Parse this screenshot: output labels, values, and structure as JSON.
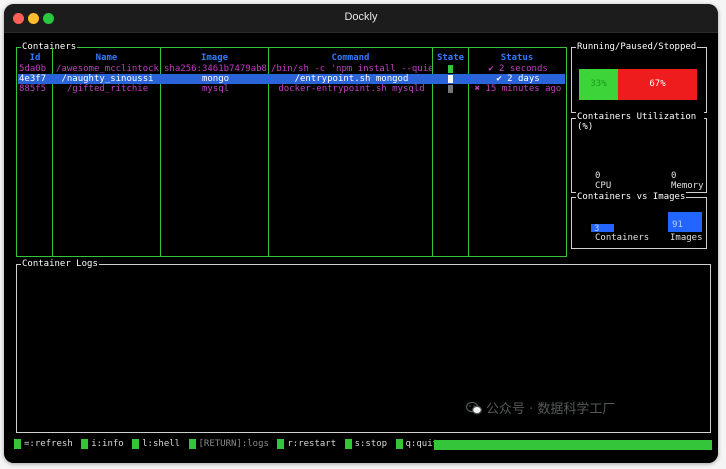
{
  "window": {
    "title": "Dockly"
  },
  "containers": {
    "title": "Containers",
    "headers": [
      "Id",
      "Name",
      "Image",
      "Command",
      "State",
      "Status"
    ],
    "rows": [
      {
        "id": "5da0b",
        "name": "/awesome_mcclintock",
        "image": "sha256:3461b7479ab8",
        "command": "/bin/sh -c 'npm install --quie",
        "state": "running",
        "status": "✔ 2 seconds"
      },
      {
        "id": "4e3f7",
        "name": "/naughty_sinoussi",
        "image": "mongo",
        "command": "/entrypoint.sh mongod",
        "state": "running",
        "status": "✔ 2 days"
      },
      {
        "id": "885f5",
        "name": "/gifted_ritchie",
        "image": "mysql",
        "command": "docker-entrypoint.sh mysqld",
        "state": "stopped",
        "status": "✖ 15 minutes ago"
      }
    ],
    "selected_row": 1
  },
  "running_paused_stopped": {
    "title": "Running/Paused/Stopped",
    "running_pct": "33%",
    "stopped_pct": "67%",
    "running_fraction": 0.33,
    "colors": {
      "running": "#3dd43a",
      "stopped": "#ee1c1c"
    }
  },
  "utilization": {
    "title": "Containers Utilization (%)",
    "cpu_value": "0",
    "cpu_label": "CPU",
    "memory_value": "0",
    "memory_label": "Memory"
  },
  "containers_vs_images": {
    "title": "Containers vs Images",
    "containers_value": "3",
    "containers_label": "Containers",
    "images_value": "91",
    "images_label": "Images",
    "bar_color": "#2266ff"
  },
  "logs": {
    "title": "Container Logs"
  },
  "footer": {
    "shortcuts": [
      "=:refresh",
      "i:info",
      "l:shell",
      "[RETURN]:logs",
      "r:restart",
      "s:stop",
      "q:quit"
    ]
  },
  "watermark": {
    "text": "公众号 · 数据科学工厂"
  },
  "colors": {
    "accent": "#34c53a",
    "header": "#2f7bff",
    "selection": "#2b63d8",
    "text_purple": "#c23ec2"
  }
}
